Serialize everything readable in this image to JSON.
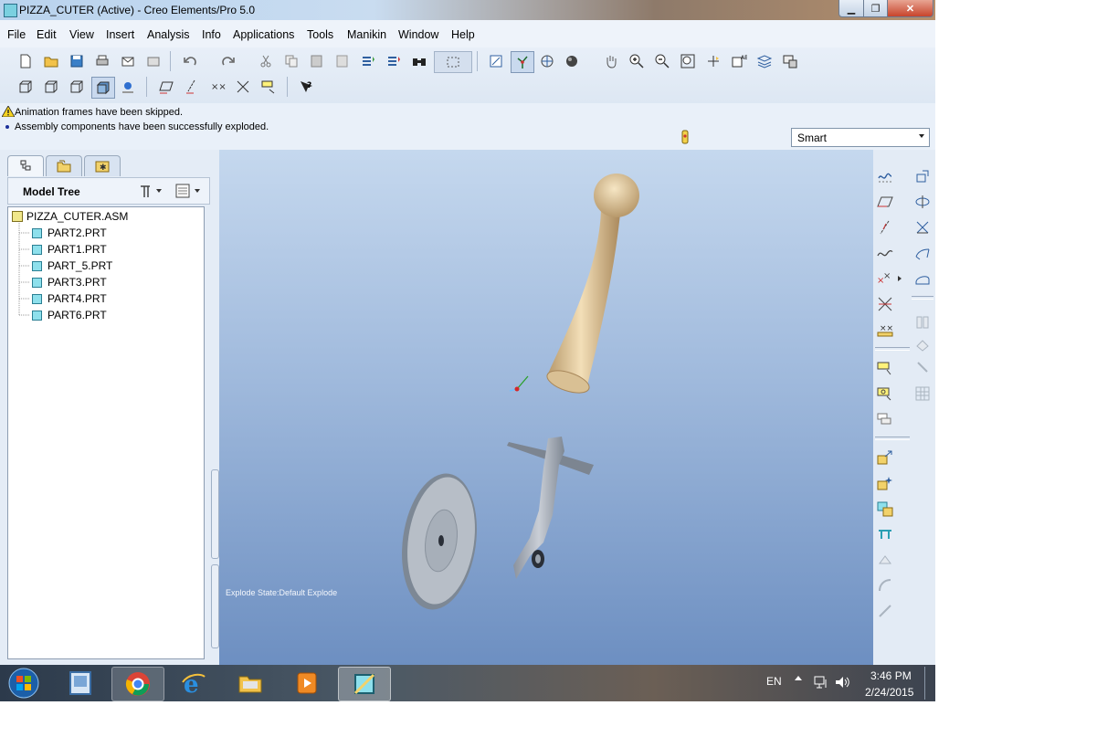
{
  "window": {
    "title": "PIZZA_CUTER (Active) - Creo Elements/Pro 5.0"
  },
  "menu": [
    "File",
    "Edit",
    "View",
    "Insert",
    "Analysis",
    "Info",
    "Applications",
    "Tools",
    "Manikin",
    "Window",
    "Help"
  ],
  "messages": [
    {
      "type": "warning",
      "text": "Animation frames have been skipped."
    },
    {
      "type": "info",
      "text": "Assembly components have been successfully exploded."
    }
  ],
  "filter": {
    "selected": "Smart"
  },
  "model_tree": {
    "title": "Model Tree",
    "root": "PIZZA_CUTER.ASM",
    "parts": [
      "PART2.PRT",
      "PART1.PRT",
      "PART_5.PRT",
      "PART3.PRT",
      "PART4.PRT",
      "PART6.PRT"
    ]
  },
  "graphics": {
    "explode_state": "Explode State:Default Explode"
  },
  "taskbar": {
    "language": "EN",
    "time": "3:46 PM",
    "date": "2/24/2015"
  }
}
